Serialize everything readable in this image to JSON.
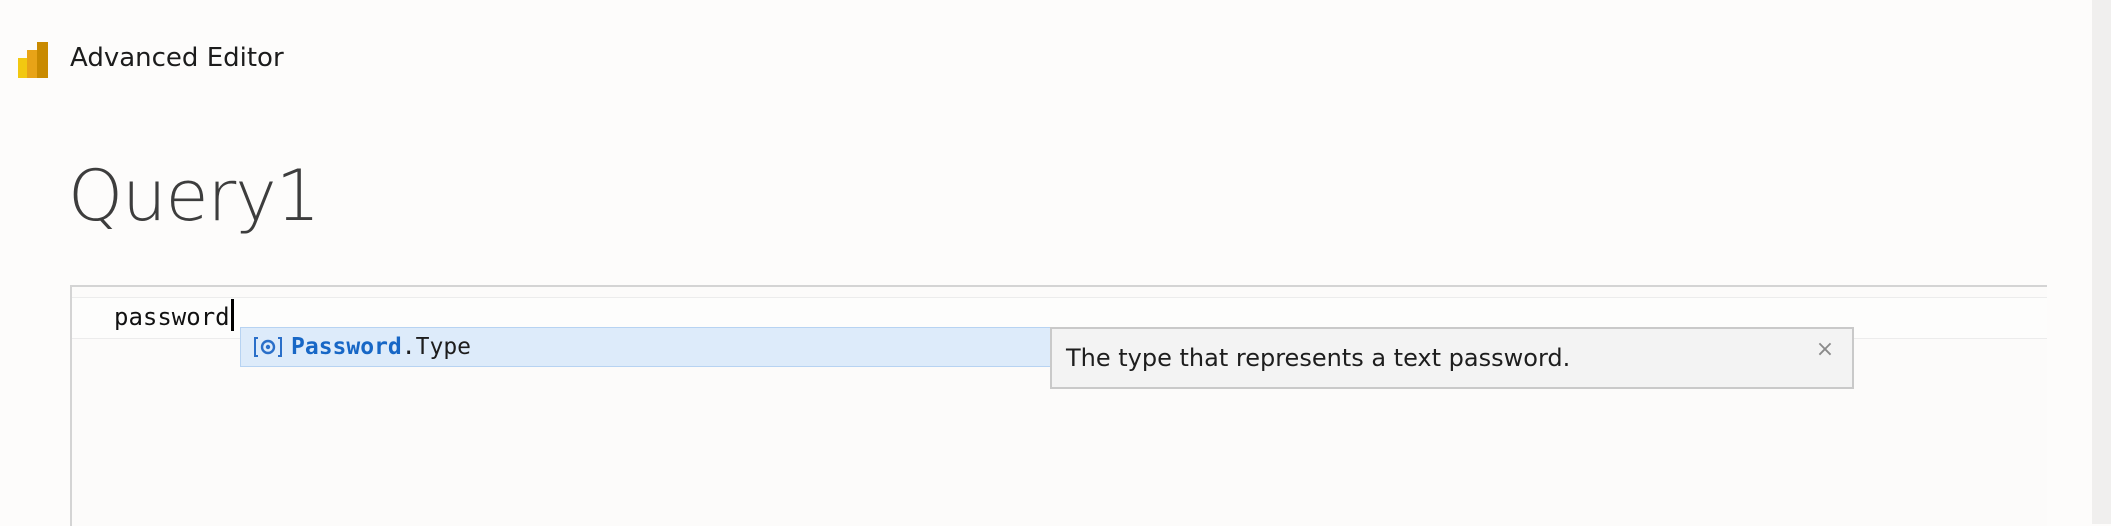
{
  "window": {
    "title": "Advanced Editor",
    "icon": "power-bi-logo",
    "icon_colors": [
      "#f2c811",
      "#e8a317",
      "#c98a00"
    ]
  },
  "query": {
    "name": "Query1"
  },
  "editor": {
    "line_1": "password"
  },
  "autocomplete": {
    "items": [
      {
        "icon": "field-icon",
        "match": "Password",
        "rest": ".Type",
        "selected": true
      }
    ],
    "selected_bg": "#ddebfa",
    "match_color": "#1767c6"
  },
  "tooltip": {
    "text": "The type that represents a text password.",
    "close_glyph": "×"
  }
}
